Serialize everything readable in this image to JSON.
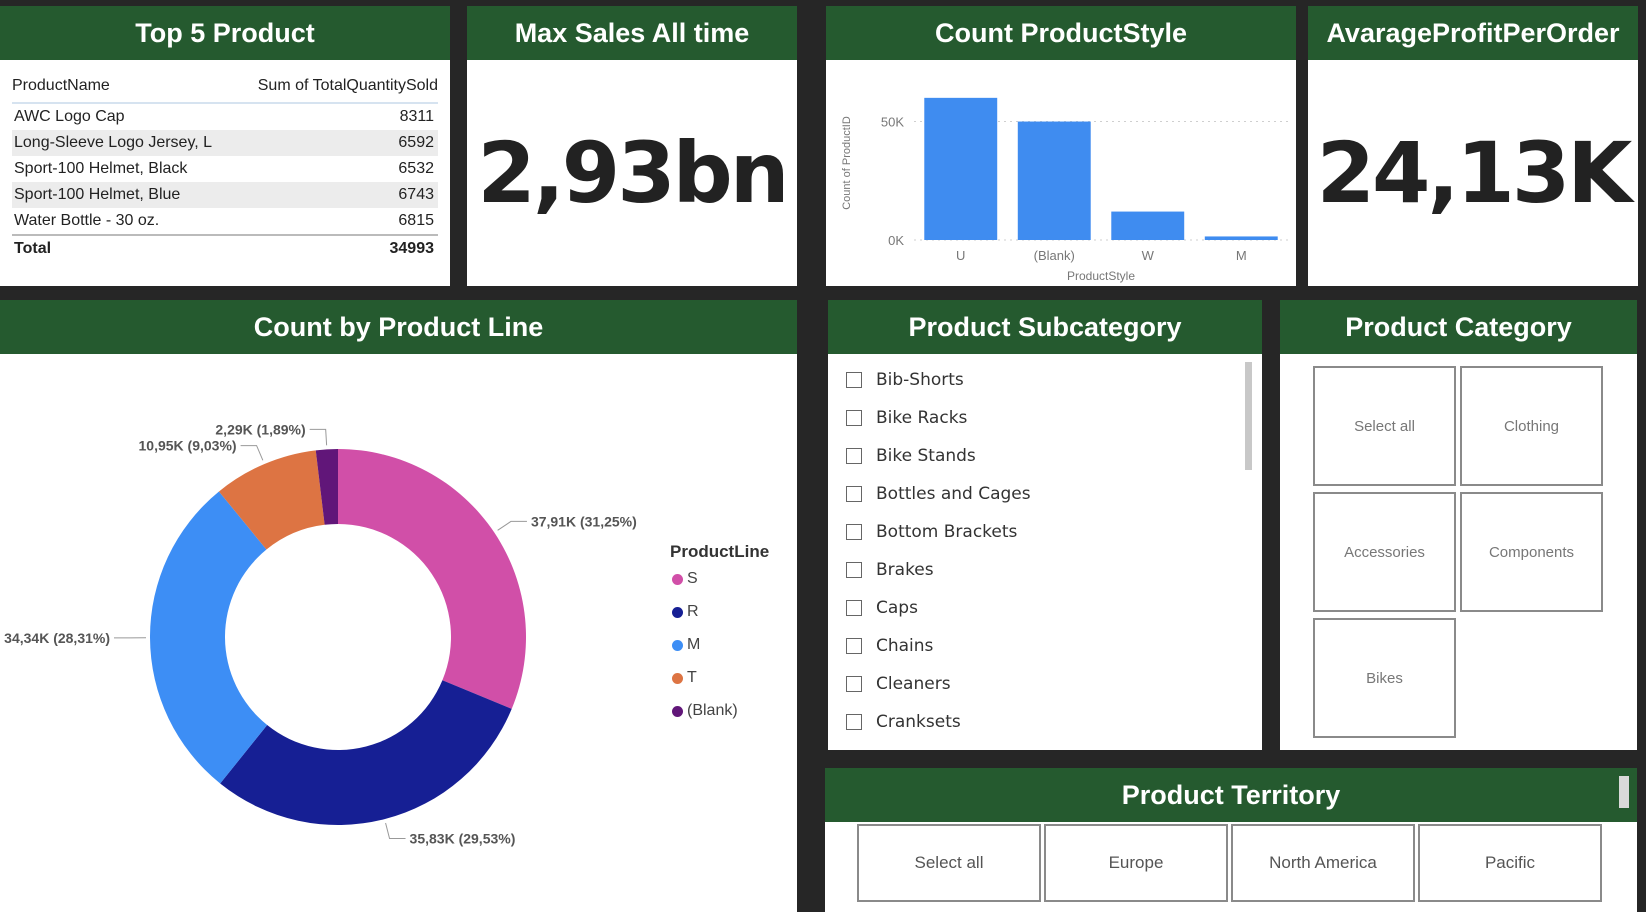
{
  "top5": {
    "title": "Top 5 Product",
    "col_name": "ProductName",
    "col_value": "Sum of TotalQuantitySold",
    "rows": [
      {
        "name": "AWC Logo Cap",
        "value": "8311"
      },
      {
        "name": "Long-Sleeve Logo Jersey, L",
        "value": "6592"
      },
      {
        "name": "Sport-100 Helmet, Black",
        "value": "6532"
      },
      {
        "name": "Sport-100 Helmet, Blue",
        "value": "6743"
      },
      {
        "name": "Water Bottle - 30 oz.",
        "value": "6815"
      }
    ],
    "total_label": "Total",
    "total_value": "34993"
  },
  "max_sales": {
    "title": "Max Sales All time",
    "value": "2,93bn"
  },
  "avg_profit": {
    "title": "AvarageProfitPerOrder",
    "value": "24,13K"
  },
  "style_chart": {
    "title": "Count ProductStyle"
  },
  "line_chart": {
    "title": "Count by Product Line"
  },
  "subcategory": {
    "title": "Product Subcategory",
    "items": [
      "Bib-Shorts",
      "Bike Racks",
      "Bike Stands",
      "Bottles and Cages",
      "Bottom Brackets",
      "Brakes",
      "Caps",
      "Chains",
      "Cleaners",
      "Cranksets"
    ]
  },
  "category": {
    "title": "Product Category",
    "tiles": [
      "Select all",
      "Clothing",
      "Accessories",
      "Components",
      "Bikes"
    ]
  },
  "territory": {
    "title": "Product Territory",
    "tiles": [
      "Select all",
      "Europe",
      "North America",
      "Pacific"
    ]
  },
  "chart_data": [
    {
      "type": "bar",
      "title": "Count ProductStyle",
      "categories": [
        "U",
        "(Blank)",
        "W",
        "M"
      ],
      "values": [
        60000,
        50000,
        12000,
        1500
      ],
      "xlabel": "ProductStyle",
      "ylabel": "Count of ProductID",
      "yticks": [
        "0K",
        "50K"
      ],
      "ylim": [
        0,
        65000
      ],
      "color": "#3f8cf0"
    },
    {
      "type": "pie",
      "subtype": "donut",
      "title": "Count by Product Line",
      "legend_title": "ProductLine",
      "legend_position": "right",
      "slices": [
        {
          "name": "S",
          "value": 37910,
          "label": "37,91K (31,25%)",
          "color": "#d14fa8"
        },
        {
          "name": "R",
          "value": 35830,
          "label": "35,83K (29,53%)",
          "color": "#161f94"
        },
        {
          "name": "M",
          "value": 34340,
          "label": "34,34K (28,31%)",
          "color": "#3d8ef5"
        },
        {
          "name": "T",
          "value": 10950,
          "label": "10,95K (9,03%)",
          "color": "#dd7443"
        },
        {
          "name": "(Blank)",
          "value": 2290,
          "label": "2,29K (1,89%)",
          "color": "#611679"
        }
      ]
    }
  ]
}
